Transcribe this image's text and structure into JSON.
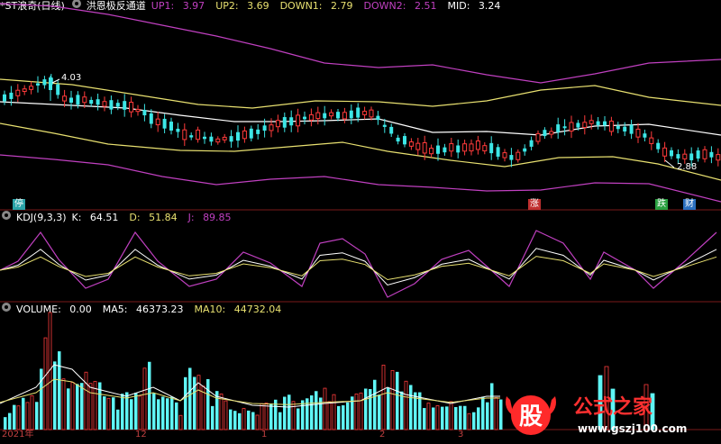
{
  "main_header": {
    "stock": "*ST浪奇(日线)",
    "indicator": "洪恩极反通道",
    "up1_label": "UP1:",
    "up1_value": "3.97",
    "up2_label": "UP2:",
    "up2_value": "3.69",
    "down1_label": "DOWN1:",
    "down1_value": "2.79",
    "down2_label": "DOWN2:",
    "down2_value": "2.51",
    "mid_label": "MID:",
    "mid_value": "3.24"
  },
  "price_annotations": {
    "high": "4.03",
    "low": "2.88"
  },
  "signal_tags": [
    {
      "text": "停",
      "color": "#2aa3a8"
    },
    {
      "text": "涨",
      "color": "#c03030"
    },
    {
      "text": "跌",
      "color": "#2aa040"
    },
    {
      "text": "财",
      "color": "#2a6fc0"
    }
  ],
  "kdj_header": {
    "name": "KDJ(9,3,3)",
    "k_label": "K:",
    "k_value": "64.51",
    "d_label": "D:",
    "d_value": "51.84",
    "j_label": "J:",
    "j_value": "89.85"
  },
  "volume_header": {
    "name": "VOLUME:",
    "value": "0.00",
    "ma5_label": "MA5:",
    "ma5_value": "46373.23",
    "ma10_label": "MA10:",
    "ma10_value": "44732.04"
  },
  "time_axis": [
    "2021年",
    "12",
    "1",
    "2",
    "3"
  ],
  "watermark": {
    "char": "股",
    "text": "公式之家",
    "url": "www.gszj100.com"
  },
  "colors": {
    "up": "#ff3b3b",
    "down": "#3ce6e6",
    "up1": "#c040c0",
    "up2": "#e8e070",
    "mid": "#ffffff",
    "k": "#ffffff",
    "d": "#e8e070",
    "j": "#c040c0",
    "vol_up": "#ff3b3b",
    "vol_down": "#5ff5f5"
  }
}
